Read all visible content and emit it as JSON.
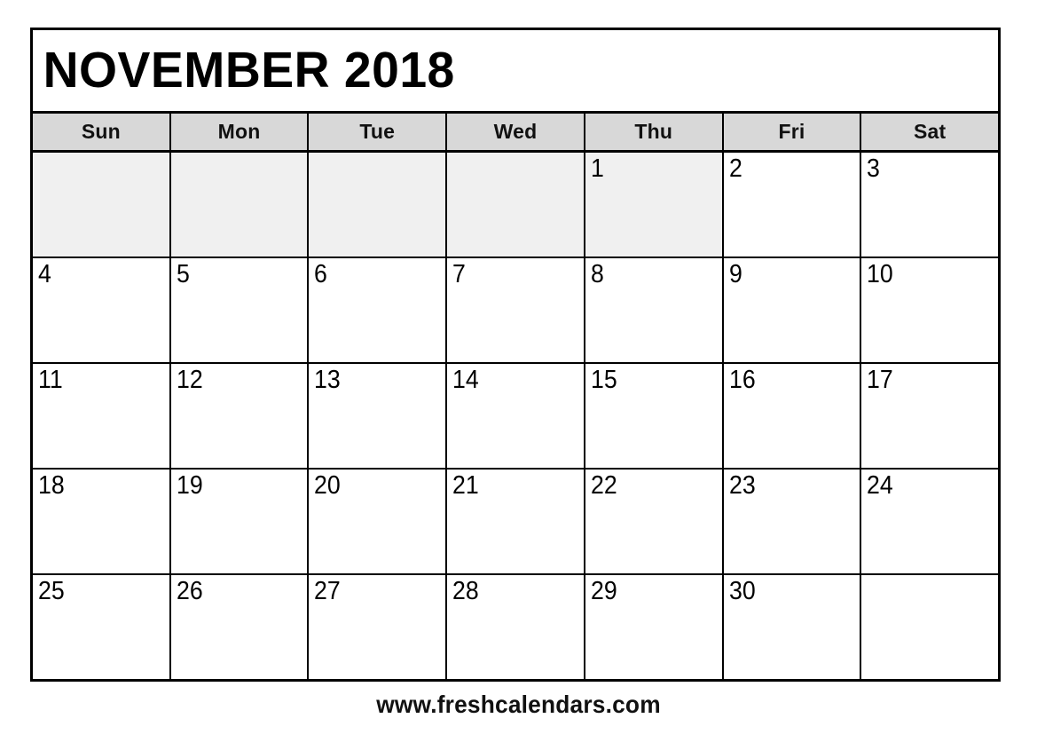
{
  "calendar": {
    "title": "NOVEMBER 2018",
    "month": "NOVEMBER",
    "year": "2018",
    "weekday_headers": [
      "Sun",
      "Mon",
      "Tue",
      "Wed",
      "Thu",
      "Fri",
      "Sat"
    ],
    "weeks": [
      [
        {
          "day": "",
          "shaded": true
        },
        {
          "day": "",
          "shaded": true
        },
        {
          "day": "",
          "shaded": true
        },
        {
          "day": "",
          "shaded": true
        },
        {
          "day": "1",
          "shaded": true
        },
        {
          "day": "2",
          "shaded": false
        },
        {
          "day": "3",
          "shaded": false
        }
      ],
      [
        {
          "day": "4",
          "shaded": false
        },
        {
          "day": "5",
          "shaded": false
        },
        {
          "day": "6",
          "shaded": false
        },
        {
          "day": "7",
          "shaded": false
        },
        {
          "day": "8",
          "shaded": false
        },
        {
          "day": "9",
          "shaded": false
        },
        {
          "day": "10",
          "shaded": false
        }
      ],
      [
        {
          "day": "11",
          "shaded": false
        },
        {
          "day": "12",
          "shaded": false
        },
        {
          "day": "13",
          "shaded": false
        },
        {
          "day": "14",
          "shaded": false
        },
        {
          "day": "15",
          "shaded": false
        },
        {
          "day": "16",
          "shaded": false
        },
        {
          "day": "17",
          "shaded": false
        }
      ],
      [
        {
          "day": "18",
          "shaded": false
        },
        {
          "day": "19",
          "shaded": false
        },
        {
          "day": "20",
          "shaded": false
        },
        {
          "day": "21",
          "shaded": false
        },
        {
          "day": "22",
          "shaded": false
        },
        {
          "day": "23",
          "shaded": false
        },
        {
          "day": "24",
          "shaded": false
        }
      ],
      [
        {
          "day": "25",
          "shaded": false
        },
        {
          "day": "26",
          "shaded": false
        },
        {
          "day": "27",
          "shaded": false
        },
        {
          "day": "28",
          "shaded": false
        },
        {
          "day": "29",
          "shaded": false
        },
        {
          "day": "30",
          "shaded": false
        },
        {
          "day": "",
          "shaded": false
        }
      ]
    ]
  },
  "footer": {
    "website": "www.freshcalendars.com"
  },
  "colors": {
    "border": "#000000",
    "header_background": "#d8d8d8",
    "shaded_cell": "#f0f0f0",
    "page_background": "#ffffff",
    "text": "#000000"
  }
}
